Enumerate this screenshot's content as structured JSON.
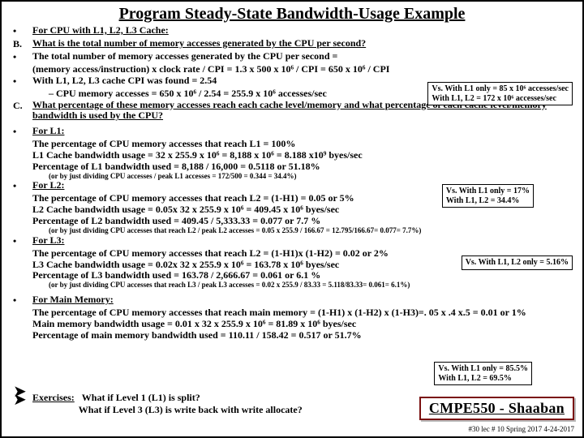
{
  "title": "Program Steady-State Bandwidth-Usage Example",
  "rows": {
    "r1_bullet": "•",
    "r1": "For CPU with L1, L2, L3 Cache:",
    "rB_bullet": "B.",
    "rB": "What is the total number of memory accesses generated by the CPU per second?",
    "r2_bullet": "•",
    "r2": "The total number of memory accesses generated by the CPU per second  =",
    "r2b": "(memory access/instruction)  x clock rate / CPI  =  1.3 x 500 x 10⁶ / CPI =  650 x 10⁶ / CPI",
    "r3_bullet": "•",
    "r3": "With  L1, L2, L3 cache CPI was found = 2.54",
    "r3sub": "–      CPU memory accesses = 650 x 10⁶ / 2.54  =  255.9  x   10⁶  accesses/sec",
    "rC_bullet": "C.",
    "rC": "What percentage of these memory accesses reach each cache level/memory and what percentage of each cache level/memory bandwidth is used by the CPU?",
    "L1_bullet": "•",
    "L1a": "For L1:",
    "L1b": "The percentage of CPU memory accesses that reach L1 = 100%",
    "L1c": "L1 Cache bandwidth usage =  32 x 255.9 x  10⁶ =  8,188 x 10⁶ = 8.188 x10⁹ byes/sec",
    "L1d": "Percentage of L1 bandwidth used = 8,188 / 16,000 = 0.5118 or  51.18%",
    "L1tiny": "(or   by just dividing   CPU accesses / peak L1 accesses  =  172/500  =  0.344 = 34.4%)",
    "L2_bullet": "•",
    "L2a": "For L2:",
    "L2b": "The percentage of CPU memory accesses that reach L2 = (1-H1) = 0.05 or  5%",
    "L2c": "L2 Cache bandwidth usage =  0.05x 32 x 255.9 x  10⁶ =  409.45 x 10⁶ byes/sec",
    "L2d": "Percentage of L2 bandwidth used = 409.45 / 5,333.33 = 0.077 or 7.7 %",
    "L2tiny": "(or   by just dividing   CPU accesses that reach L2 / peak L2 accesses  =  0.05 x 255.9 / 166.67 = 12.795/166.67=  0.077= 7.7%)",
    "L3_bullet": "•",
    "L3a": "For L3:",
    "L3b": "The percentage of CPU memory accesses that reach L2 = (1-H1)x (1-H2) = 0.02 or  2%",
    "L3c": "L3 Cache bandwidth usage =  0.02x 32 x 255.9 x  10⁶ =  163.78 x 10⁶ byes/sec",
    "L3d": "Percentage of L3 bandwidth used = 163.78 / 2,666.67 = 0.061 or 6.1 %",
    "L3tiny": "(or   by just dividing   CPU accesses that reach L3 / peak L3 accesses  =  0.02 x 255.9 / 83.33 = 5.118/83.33=  0.061= 6.1%)",
    "MM_bullet": "•",
    "MMa": "For Main Memory:",
    "MMb": "The percentage of CPU memory accesses that reach main memory =  (1-H1) x (1-H2) x (1-H3)=. 05 x .4 x.5 =  0.01 or  1%",
    "MMc": "Main memory bandwidth usage =  0.01 x 32 x 255.9 x  10⁶ =  81.89 x 10⁶ byes/sec",
    "MMd": "Percentage of main memory bandwidth used = 110.11 / 158.42 = 0.517 or  51.7%"
  },
  "vs": {
    "v1a": "Vs.  With L1 only = 85  x  10⁶  accesses/sec",
    "v1b": "With L1, L2 = 172 x  10⁶  accesses/sec",
    "v2a": "Vs.  With L1 only = 17%",
    "v2b": "With L1, L2 =  34.4%",
    "v3": "Vs.  With L1, L2 only = 5.16%",
    "v4a": "Vs.  With L1 only = 85.5%",
    "v4b": "With L1, L2 =  69.5%"
  },
  "exercises": {
    "label": "Exercises:",
    "e1": "What if Level 1 (L1) is split?",
    "e2": "What if Level 3 (L3) is write back with write allocate?"
  },
  "brand": "CMPE550 - Shaaban",
  "meta": "#30   lec # 10    Spring 2017   4-24-2017"
}
